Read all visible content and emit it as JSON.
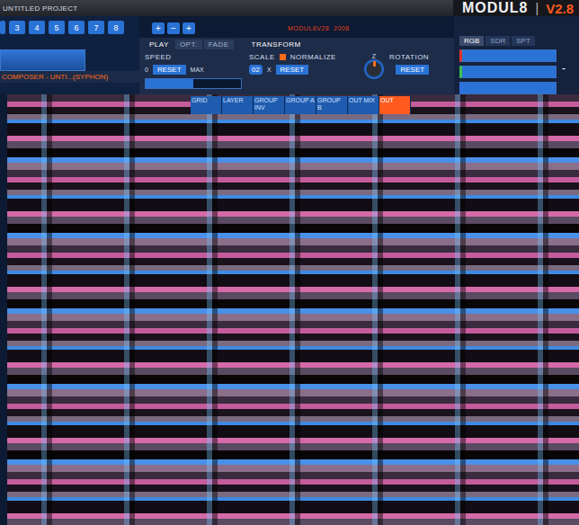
{
  "window": {
    "title": "UNTITLED PROJECT",
    "logo": "MODUL8",
    "separator": "|",
    "version": "V2.8"
  },
  "layer_tabs": [
    {
      "label": "3",
      "selected": false
    },
    {
      "label": "4",
      "selected": false
    },
    {
      "label": "5",
      "selected": false
    },
    {
      "label": "6",
      "selected": false
    },
    {
      "label": "7",
      "selected": false
    },
    {
      "label": "8",
      "selected": false
    }
  ],
  "toolbar_buttons": [
    "+",
    "−",
    "+"
  ],
  "build_label": "MODUL8V28  2008",
  "composer": {
    "label": "COMPOSER - UNTI...(SYPHON)",
    "level": 1
  },
  "panel_tabs": [
    {
      "label": "PLAY",
      "selected": true
    },
    {
      "label": "OPT.",
      "selected": false
    },
    {
      "label": "FADE",
      "selected": false
    }
  ],
  "transform_title": "TRANSFORM",
  "speed": {
    "label": "SPEED",
    "min": "0",
    "reset": "RESET",
    "max": "MAX",
    "level": 0.5
  },
  "scale": {
    "label": "SCALE",
    "value": "02",
    "unit": "X",
    "reset": "RESET"
  },
  "normalize": {
    "label": "NORMALIZE",
    "checked": true
  },
  "rotation": {
    "label": "ROTATION",
    "reset": "RESET",
    "axis": "Z"
  },
  "color_tabs": [
    {
      "label": "RGB",
      "selected": true
    },
    {
      "label": "SDR",
      "selected": false
    },
    {
      "label": "SPT",
      "selected": false
    }
  ],
  "color_channels": [
    {
      "color": "#e0342c",
      "level": 1
    },
    {
      "color": "#3cc04a",
      "level": 1
    },
    {
      "color": "#2f6fe0",
      "level": 1
    }
  ],
  "side_button": "-",
  "video_menu": [
    {
      "label": "GRID",
      "selected": false
    },
    {
      "label": "LAYER",
      "selected": false
    },
    {
      "label": "GROUP INV",
      "selected": false
    },
    {
      "label": "GROUP A",
      "selected": false
    },
    {
      "label": "GROUP B",
      "selected": false
    },
    {
      "label": "OUT MIX",
      "selected": false
    },
    {
      "label": "OUT",
      "selected": true
    }
  ]
}
